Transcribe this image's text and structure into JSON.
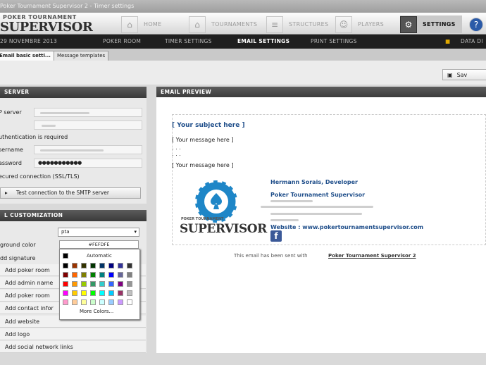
{
  "titlebar": {
    "text": "Poker Tournament Supervisor 2 - Timer settings"
  },
  "logo": {
    "small": "POKER TOURNAMENT",
    "big": "SUPERVISOR"
  },
  "nav": [
    {
      "label": "HOME",
      "icon": "home-icon"
    },
    {
      "label": "TOURNAMENTS",
      "icon": "home-icon"
    },
    {
      "label": "STRUCTURES",
      "icon": "list-icon"
    },
    {
      "label": "PLAYERS",
      "icon": "user-icon"
    },
    {
      "label": "SETTINGS",
      "icon": "gear-icon"
    },
    {
      "label": "?",
      "icon": "help-icon"
    }
  ],
  "subnav": {
    "date": "29 NOVEMBRE 2013",
    "items": [
      "POKER ROOM",
      "TIMER SETTINGS",
      "EMAIL SETTINGS",
      "PRINT SETTINGS"
    ],
    "data_folder": "DATA DI"
  },
  "tabs": [
    "Email basic setti...",
    "Message templates"
  ],
  "toolbar": {
    "save_label": "Sav"
  },
  "server": {
    "title": "SERVER",
    "smtp_label": "P server",
    "auth_label": "uthentication is required",
    "username_label": "sername",
    "password_label": "assword",
    "password_value": "●●●●●●●●●●●",
    "secure_label": "ecured connection (SSL/TLS)",
    "test_button": "Test connection to the SMTP server"
  },
  "customization": {
    "title": "L CUSTOMIZATION",
    "font_value": "pta",
    "bg_label": "ground color",
    "bg_value": "#FEFDFE",
    "signature_label": "dd signature",
    "items": [
      "Add poker room",
      "Add admin name",
      "Add poker room",
      "Add contact infor",
      "Add website",
      "Add logo",
      "Add social network links"
    ]
  },
  "picker": {
    "automatic": "Automatic",
    "more": "More Colors...",
    "rows": [
      [
        "#000000",
        "#993300",
        "#333300",
        "#003300",
        "#003366",
        "#000080",
        "#333399",
        "#333333"
      ],
      [
        "#800000",
        "#ff6600",
        "#808000",
        "#008000",
        "#008080",
        "#0000ff",
        "#666699",
        "#808080"
      ],
      [
        "#ff0000",
        "#ff9900",
        "#99cc00",
        "#339966",
        "#33cccc",
        "#3366ff",
        "#800080",
        "#969696"
      ],
      [
        "#ff00ff",
        "#ffcc00",
        "#ffff00",
        "#00ff00",
        "#00ffff",
        "#00ccff",
        "#993366",
        "#c0c0c0"
      ],
      [
        "#ff99cc",
        "#ffcc99",
        "#ffff99",
        "#ccffcc",
        "#ccffff",
        "#99ccff",
        "#cc99ff",
        "#ffffff"
      ]
    ]
  },
  "preview": {
    "title": "EMAIL PREVIEW",
    "subject": "[ Your subject here ]",
    "message1": "[ Your message here ]",
    "dots1": ". . .",
    "dots2": ". . .",
    "message2": "[ Your message here ]",
    "sig_name": "Hermann Sorais, Developer",
    "sig_company": "Poker Tournament Supervisor",
    "sig_website": "Website : www.pokertournamentsupervisor.com",
    "logo_text": "SUPERVISOR",
    "logo_small": "POKER TOURNAMENT",
    "footer_prefix": "This email has been sent with",
    "footer_link": "Poker Tournament Supervisor 2"
  },
  "colors": {
    "accent_blue": "#1f4e8a",
    "dark": "#3a3a3a"
  }
}
